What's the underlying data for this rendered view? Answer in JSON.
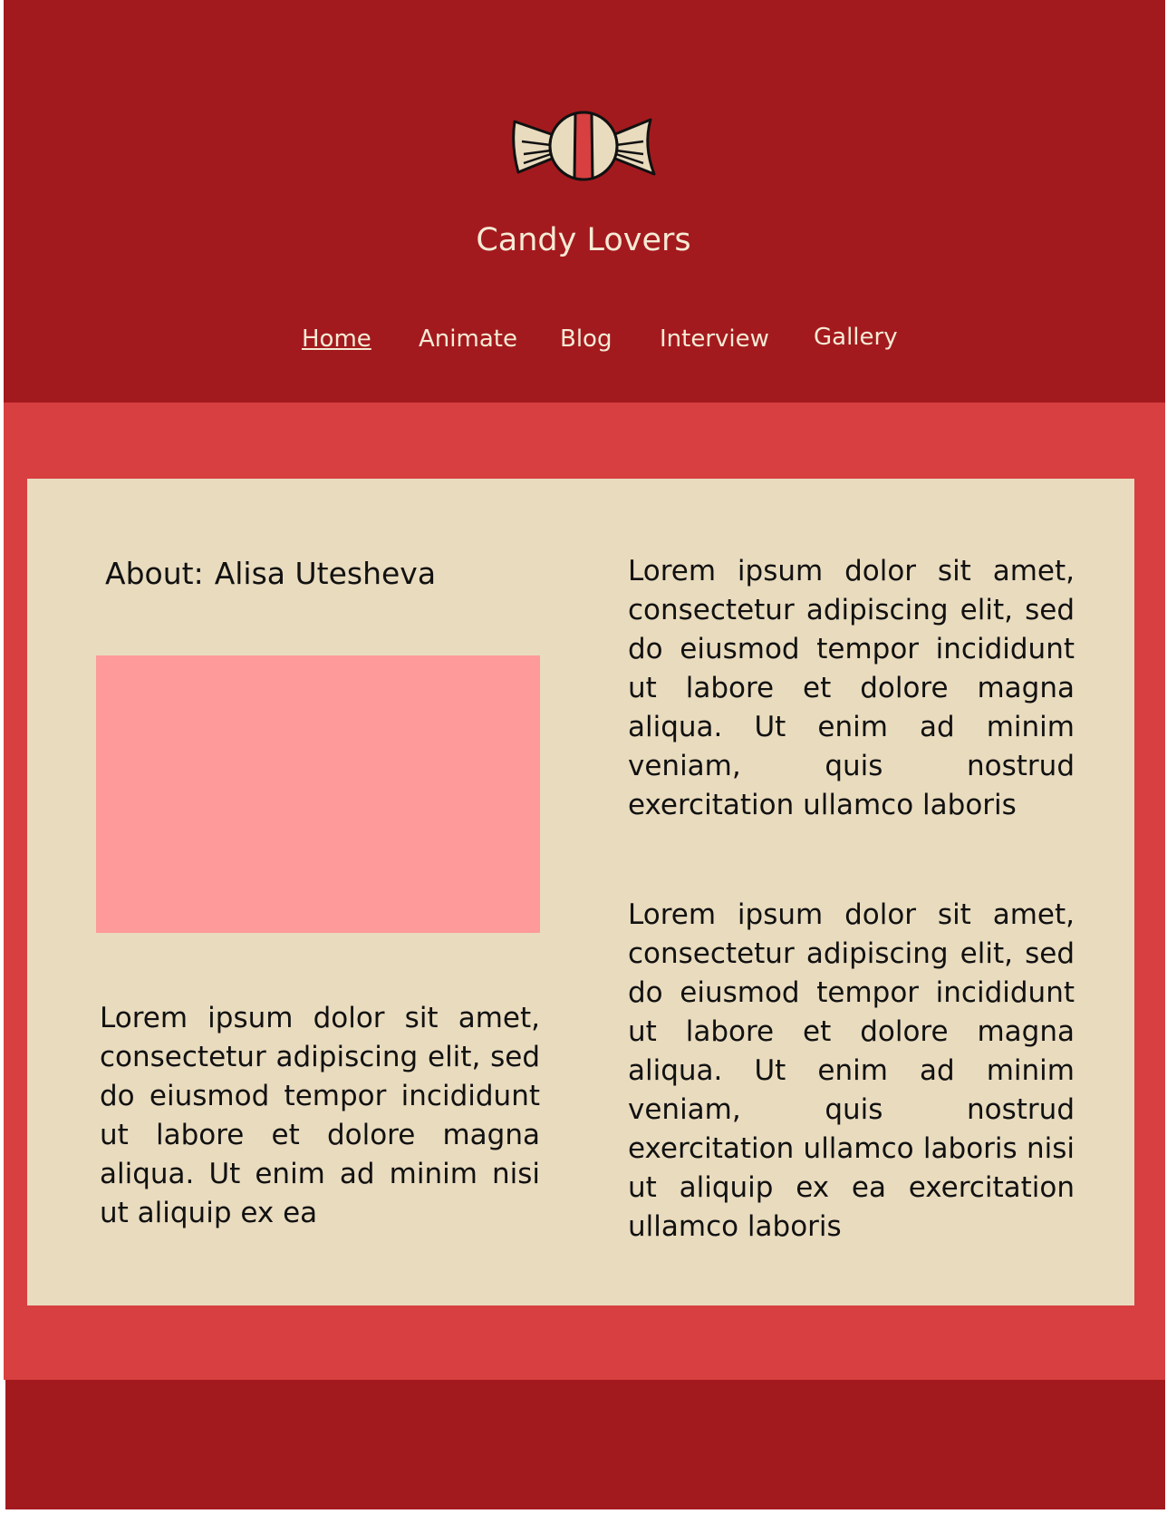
{
  "header": {
    "site_title": "Candy Lovers",
    "logo_icon": "candy-icon"
  },
  "nav": {
    "items": [
      {
        "label": "Home",
        "active": true
      },
      {
        "label": "Animate",
        "active": false
      },
      {
        "label": "Blog",
        "active": false
      },
      {
        "label": "Interview",
        "active": false
      },
      {
        "label": "Gallery",
        "active": false
      }
    ]
  },
  "about": {
    "label": "About:",
    "name": "Alisa Utesheva"
  },
  "content": {
    "left_paragraph": "Lorem ipsum dolor sit amet, consectetur adipiscing elit, sed do eiusmod tempor incididunt ut labore et dolore magna aliqua. Ut enim ad minim nisi ut aliquip ex ea",
    "right_paragraph_1": "Lorem ipsum dolor sit amet, consectetur adipiscing elit, sed do eiusmod tempor incididunt ut labore et dolore magna aliqua. Ut enim ad minim veniam, quis nostrud exercitation ullamco laboris",
    "right_paragraph_2": "Lorem ipsum dolor sit amet, consectetur adipiscing elit, sed do eiusmod tempor incididunt ut labore et dolore magna aliqua. Ut enim ad minim veniam, quis nostrud exercitation ullamco laboris nisi ut aliquip ex ea exercitation ullamco laboris"
  },
  "colors": {
    "header_bg": "#a31a1e",
    "section_bg": "#d83f40",
    "card_bg": "#e9dbbe",
    "image_placeholder": "#fe9a99",
    "header_text": "#f6ead5",
    "body_text": "#111111"
  }
}
